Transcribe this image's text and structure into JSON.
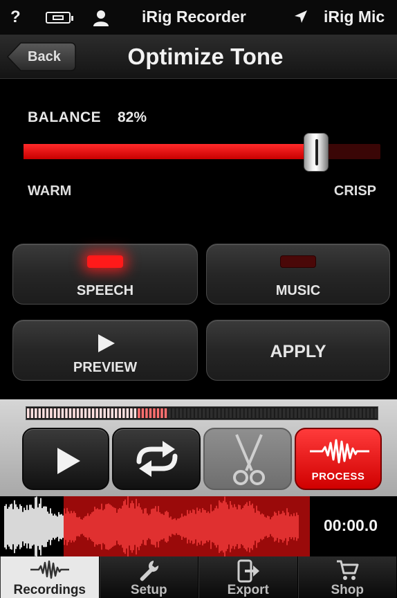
{
  "status_bar": {
    "help": "?",
    "app_name": "iRig Recorder",
    "input_device": "iRig Mic",
    "icons": [
      "battery-icon",
      "person-icon",
      "location-arrow-icon"
    ]
  },
  "nav": {
    "back_label": "Back",
    "title": "Optimize Tone"
  },
  "balance": {
    "label": "BALANCE",
    "value_text": "82%",
    "value": 0.82,
    "left_label": "WARM",
    "right_label": "CRISP"
  },
  "modes": {
    "speech_label": "SPEECH",
    "speech_active": true,
    "music_label": "MUSIC",
    "music_active": false
  },
  "actions": {
    "preview_label": "PREVIEW",
    "apply_label": "APPLY"
  },
  "transport": {
    "meter_level": 0.4,
    "process_label": "PROCESS",
    "icons": [
      "play-icon",
      "loop-icon",
      "scissors-icon",
      "waveform-icon"
    ]
  },
  "waveform": {
    "time": "00:00.0",
    "selection_start": 0.16,
    "selection_end": 0.78
  },
  "tabs": [
    {
      "label": "Recordings",
      "icon": "waveform-icon",
      "active": true
    },
    {
      "label": "Setup",
      "icon": "wrench-icon",
      "active": false
    },
    {
      "label": "Export",
      "icon": "export-icon",
      "active": false
    },
    {
      "label": "Shop",
      "icon": "cart-icon",
      "active": false
    }
  ],
  "colors": {
    "accent_red": "#ff1a1a",
    "dark_red": "#4a0808",
    "waveform_grey": "#d8d8d8",
    "selection_red": "#9a0a0a"
  }
}
